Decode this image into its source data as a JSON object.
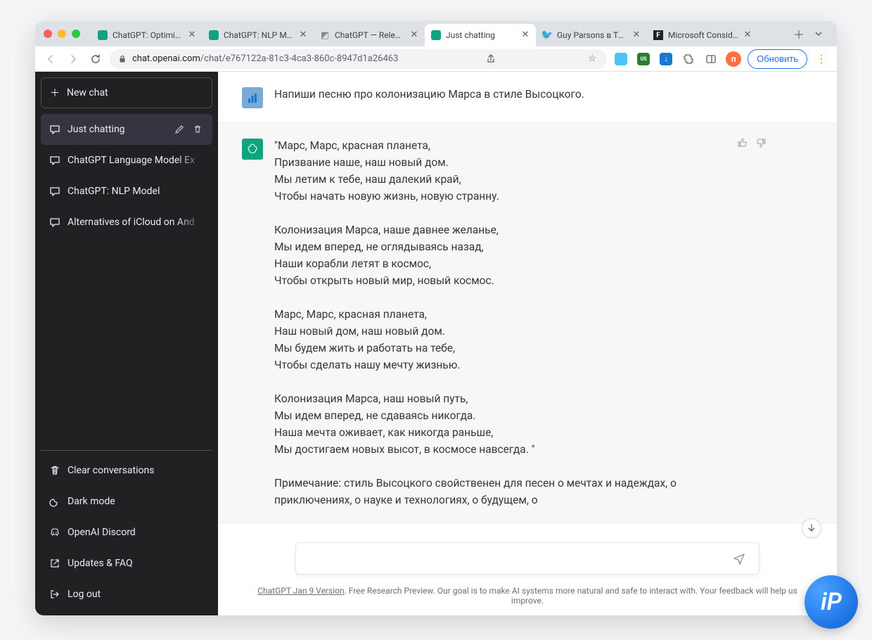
{
  "browser": {
    "tabs": [
      {
        "label": "ChatGPT: Optimizing",
        "favicon": "gpt",
        "active": false
      },
      {
        "label": "ChatGPT: NLP Model",
        "favicon": "gpt",
        "active": false
      },
      {
        "label": "ChatGPT — Release",
        "favicon": "rel",
        "active": false
      },
      {
        "label": "Just chatting",
        "favicon": "gpt",
        "active": true
      },
      {
        "label": "Guy Parsons в Твит",
        "favicon": "tw",
        "active": false
      },
      {
        "label": "Microsoft Considers",
        "favicon": "f",
        "active": false
      }
    ],
    "url_host": "chat.openai.com",
    "url_path": "/chat/e767122a-81c3-4ca3-860c-8947d1a26463",
    "update_label": "Обновить"
  },
  "sidebar": {
    "new_chat": "New chat",
    "conversations": [
      {
        "label": "Just chatting",
        "active": true
      },
      {
        "label": "ChatGPT Language Model Ex",
        "active": false
      },
      {
        "label": "ChatGPT: NLP Model",
        "active": false
      },
      {
        "label": "Alternatives of iCloud on And",
        "active": false
      }
    ],
    "actions": {
      "clear": "Clear conversations",
      "dark": "Dark mode",
      "discord": "OpenAI Discord",
      "faq": "Updates & FAQ",
      "logout": "Log out"
    }
  },
  "chat": {
    "user_message": "Напиши песню про колонизацию Марса в стиле Высоцкого.",
    "assistant_message": "\"Марс, Марс, красная планета,\nПризвание наше, наш новый дом.\nМы летим к тебе, наш далекий край,\nЧтобы начать новую жизнь, новую странну.\n\nКолонизация Марса, наше давнее желанье,\nМы идем вперед, не оглядываясь назад,\nНаши корабли летят в космос,\nЧтобы открыть новый мир, новый космос.\n\nМарс, Марс, красная планета,\nНаш новый дом, наш новый дом.\nМы будем жить и работать на тебе,\nЧтобы сделать нашу мечту жизнью.\n\nКолонизация Марса, наш новый путь,\nМы идем вперед, не сдаваясь никогда.\nНаша мечта оживает, как никогда раньше,\nМы достигаем новых высот, в космосе навсегда. \"\n\nПримечание: стиль Высоцкого свойственен для песен о мечтах и надеждах, о приключениях, о науке и технологиях, о будущем, о",
    "input_placeholder": ""
  },
  "footer": {
    "link": "ChatGPT Jan 9 Version",
    "text": ". Free Research Preview. Our goal is to make AI systems more natural and safe to interact with. Your feedback will help us improve."
  },
  "badge": "iP"
}
